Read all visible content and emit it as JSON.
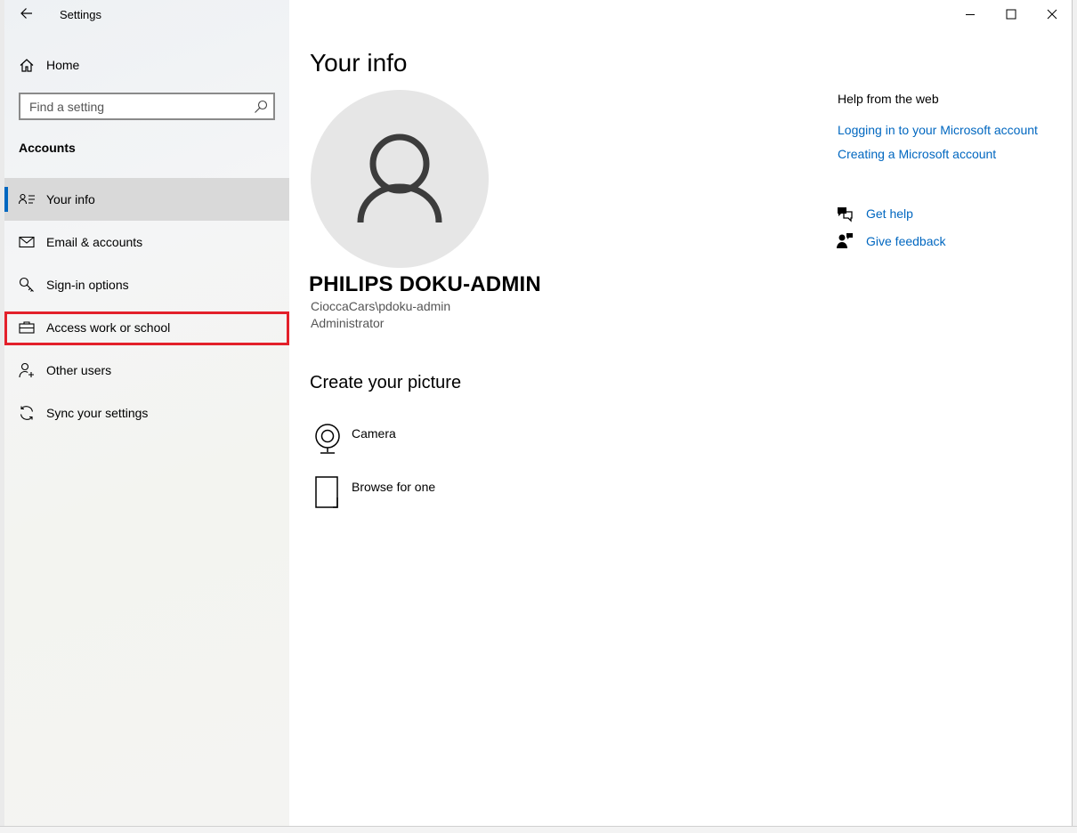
{
  "window": {
    "title": "Settings"
  },
  "sidebar": {
    "home_label": "Home",
    "search_placeholder": "Find a setting",
    "section_title": "Accounts",
    "items": [
      {
        "label": "Your info",
        "icon": "contact-info-icon",
        "selected": true
      },
      {
        "label": "Email & accounts",
        "icon": "mail-icon"
      },
      {
        "label": "Sign-in options",
        "icon": "key-icon"
      },
      {
        "label": "Access work or school",
        "icon": "briefcase-icon",
        "highlighted": true
      },
      {
        "label": "Other users",
        "icon": "add-person-icon"
      },
      {
        "label": "Sync your settings",
        "icon": "sync-icon"
      }
    ]
  },
  "main": {
    "title": "Your info",
    "user": {
      "name": "PHILIPS DOKU-ADMIN",
      "account": "CioccaCars\\pdoku-admin",
      "role": "Administrator"
    },
    "create_picture": {
      "heading": "Create your picture",
      "options": [
        {
          "label": "Camera",
          "icon": "camera-icon"
        },
        {
          "label": "Browse for one",
          "icon": "file-icon"
        }
      ]
    }
  },
  "help": {
    "heading": "Help from the web",
    "links": [
      "Logging in to your Microsoft account",
      "Creating a Microsoft account"
    ],
    "get_help": "Get help",
    "give_feedback": "Give feedback"
  },
  "colors": {
    "accent": "#0067c0",
    "highlight": "#e3202a",
    "selected_bg": "#d9d9d9"
  }
}
